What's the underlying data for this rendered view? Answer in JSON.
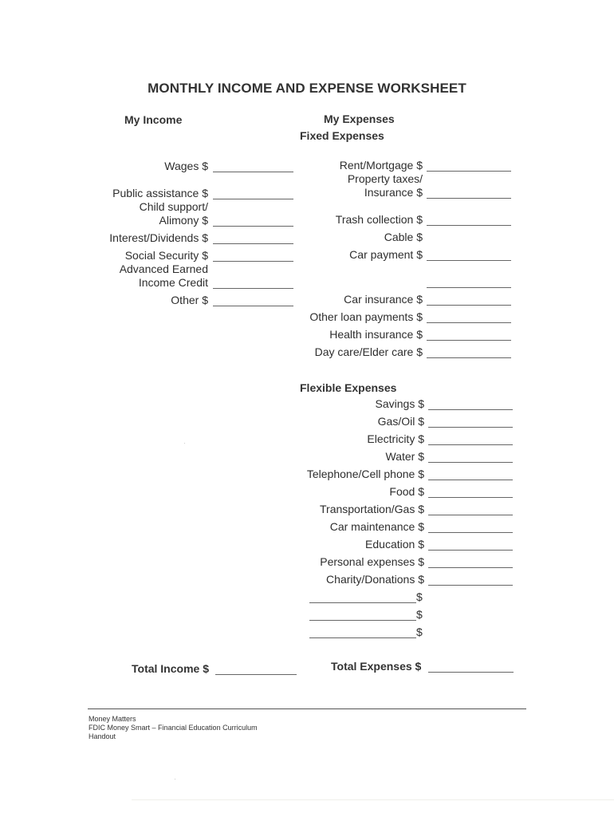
{
  "title": "MONTHLY INCOME AND EXPENSE WORKSHEET",
  "income": {
    "heading": "My Income",
    "items": [
      {
        "label_lines": [
          "Wages $"
        ]
      },
      {
        "label_lines": [
          "Public assistance $"
        ]
      },
      {
        "label_lines": [
          "Child support/",
          "Alimony $"
        ]
      },
      {
        "label_lines": [
          "Interest/Dividends $"
        ]
      },
      {
        "label_lines": [
          "Social Security $"
        ]
      },
      {
        "label_lines": [
          "Advanced Earned",
          "Income Credit"
        ]
      },
      {
        "label_lines": [
          "Other $"
        ]
      }
    ],
    "total_label": "Total Income $"
  },
  "expenses": {
    "heading": "My Expenses",
    "fixed": {
      "heading": "Fixed Expenses",
      "items": [
        {
          "label_lines": [
            "Rent/Mortgage $"
          ],
          "has_blank": true
        },
        {
          "label_lines": [
            "Property taxes/",
            "Insurance $"
          ],
          "has_blank": true
        },
        {
          "label_lines": [
            "Trash collection $"
          ],
          "has_blank": true
        },
        {
          "label_lines": [
            "Cable $"
          ],
          "has_blank": false
        },
        {
          "label_lines": [
            "Car payment $"
          ],
          "has_blank": true
        },
        {
          "label_lines": [
            ""
          ],
          "has_blank": true
        },
        {
          "label_lines": [
            "Car insurance $"
          ],
          "has_blank": true
        },
        {
          "label_lines": [
            "Other loan payments $"
          ],
          "has_blank": true
        },
        {
          "label_lines": [
            "Health insurance $"
          ],
          "has_blank": true
        },
        {
          "label_lines": [
            "Day care/Elder care $"
          ],
          "has_blank": true
        }
      ]
    },
    "flexible": {
      "heading": "Flexible Expenses",
      "items": [
        {
          "label": "Savings $"
        },
        {
          "label": "Gas/Oil $"
        },
        {
          "label": "Electricity $"
        },
        {
          "label": "Water $"
        },
        {
          "label": "Telephone/Cell phone $"
        },
        {
          "label": "Food $"
        },
        {
          "label": "Transportation/Gas $"
        },
        {
          "label": "Car maintenance $"
        },
        {
          "label": "Education $"
        },
        {
          "label": "Personal expenses $"
        },
        {
          "label": "Charity/Donations $"
        }
      ],
      "custom_rows": [
        {
          "suffix": "$"
        },
        {
          "suffix": "$"
        },
        {
          "suffix": "$"
        }
      ]
    },
    "total_label": "Total Expenses $"
  },
  "footer": {
    "lines": [
      "Money Matters",
      "FDIC Money Smart – Financial Education Curriculum",
      "Handout"
    ]
  }
}
